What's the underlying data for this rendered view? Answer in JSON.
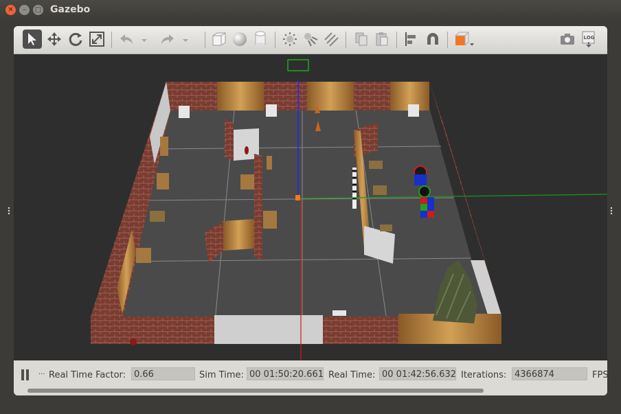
{
  "window": {
    "title": "Gazebo"
  },
  "toolbar": {
    "tools": [
      "select-mode-icon",
      "translate-mode-icon",
      "rotate-mode-icon",
      "scale-mode-icon",
      "undo-icon",
      "undo-dropdown-icon",
      "redo-icon",
      "redo-dropdown-icon",
      "box-icon",
      "sphere-icon",
      "cylinder-icon",
      "point-light-icon",
      "spot-light-icon",
      "directional-light-icon",
      "copy-icon",
      "paste-icon",
      "align-icon",
      "snap-icon",
      "view-angle-icon",
      "screenshot-icon",
      "log-icon"
    ],
    "log_label": "LOG"
  },
  "status": {
    "real_time_factor_label": "Real Time Factor:",
    "real_time_factor_value": "0.66",
    "sim_time_label": "Sim Time:",
    "sim_time_value": "00 01:50:20.661",
    "real_time_label": "Real Time:",
    "real_time_value": "00 01:42:56.632",
    "iterations_label": "Iterations:",
    "iterations_value": "4366874",
    "fps_label": "FPS:",
    "step_label": "..."
  },
  "colors": {
    "accent_orange": "#f07820",
    "origin_blue": "#2020ff",
    "axis_red": "#c81e1e",
    "axis_green": "#1a9a1a"
  }
}
